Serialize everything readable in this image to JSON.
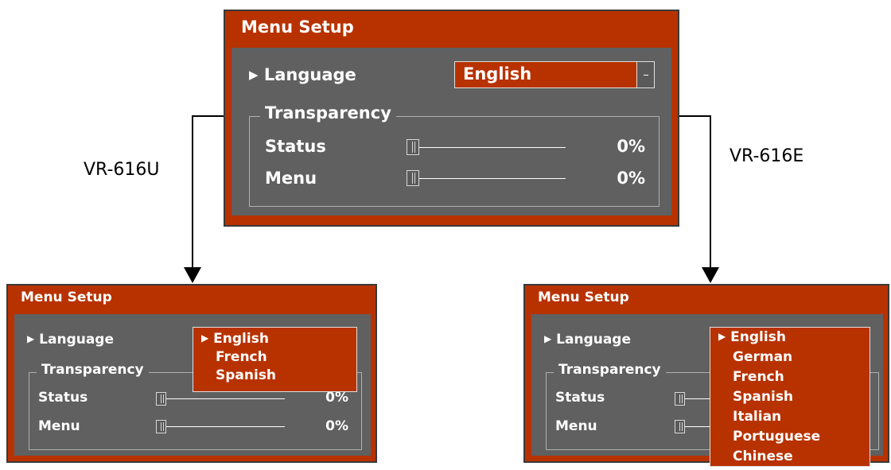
{
  "main": {
    "title": "Menu Setup",
    "language_label": "Language",
    "language_value": "English",
    "transparency_label": "Transparency",
    "status_label": "Status",
    "status_value": "0%",
    "menu_label": "Menu",
    "menu_value": "0%"
  },
  "captions": {
    "left": "VR-616U",
    "right": "VR-616E"
  },
  "left_panel": {
    "title": "Menu Setup",
    "language_label": "Language",
    "transparency_label": "Transparency",
    "status_label": "Status",
    "status_value": "0%",
    "menu_label": "Menu",
    "menu_value": "0%",
    "dropdown_options": [
      "English",
      "French",
      "Spanish"
    ],
    "selected": "English"
  },
  "right_panel": {
    "title": "Menu Setup",
    "language_label": "Language",
    "transparency_label": "Transparency",
    "status_label": "Status",
    "menu_label": "Menu",
    "dropdown_options": [
      "English",
      "German",
      "French",
      "Spanish",
      "Italian",
      "Portuguese",
      "Chinese"
    ],
    "selected": "English"
  },
  "colors": {
    "panel_red": "#b83200",
    "inner_gray": "#606060"
  }
}
